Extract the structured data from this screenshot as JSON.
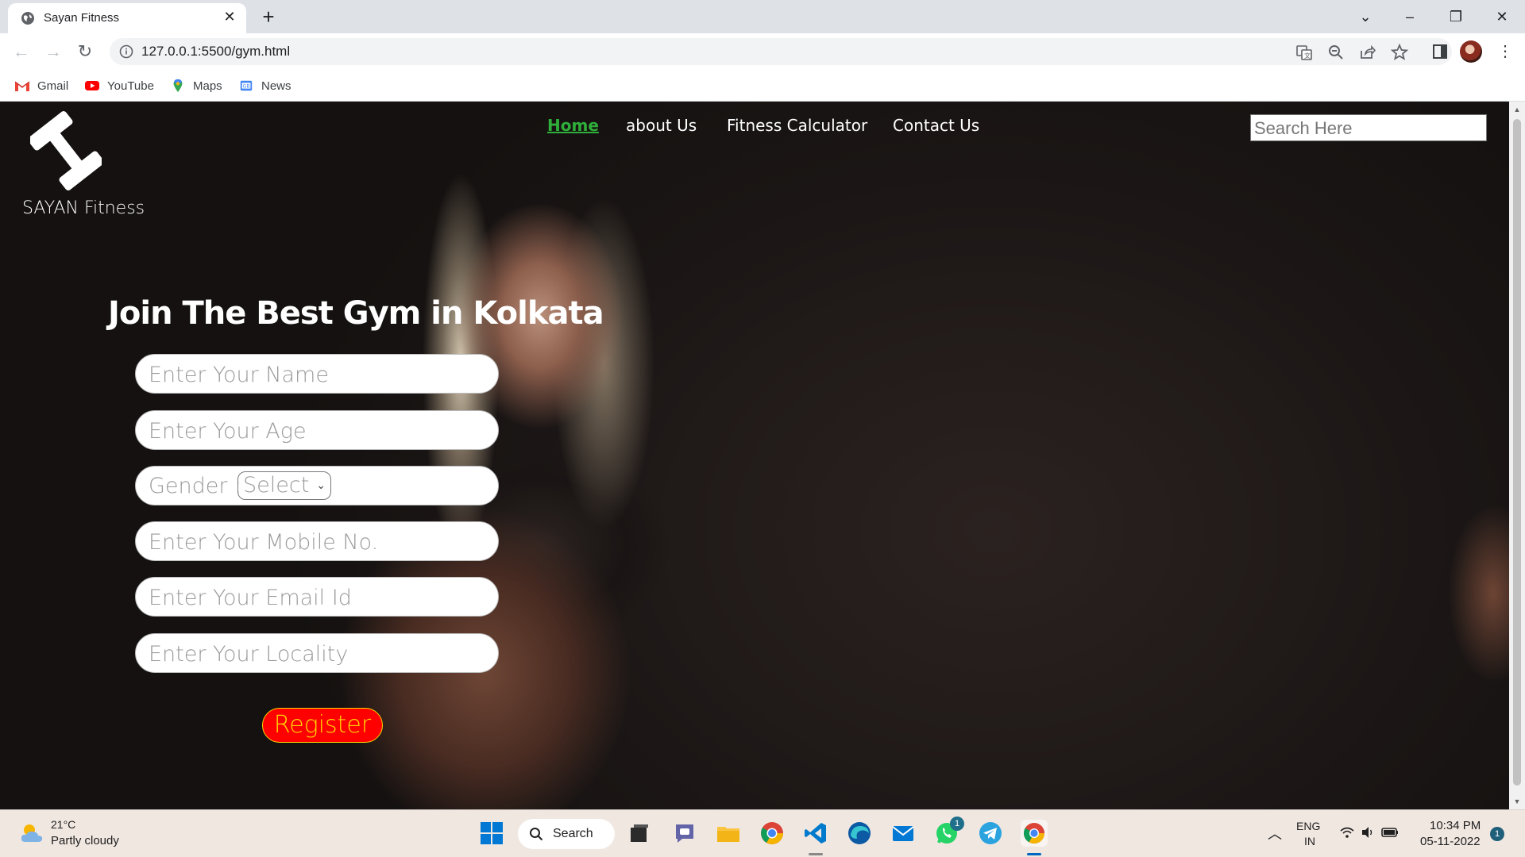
{
  "browser": {
    "tab_title": "Sayan Fitness",
    "url": "127.0.0.1:5500/gym.html",
    "bookmarks": [
      "Gmail",
      "YouTube",
      "Maps",
      "News"
    ]
  },
  "site": {
    "brand": "SAYAN Fitness",
    "nav": [
      "Home",
      "about Us",
      "Fitness Calculator",
      "Contact Us"
    ],
    "search_placeholder": "Search Here",
    "hero_title": "Join The Best Gym in Kolkata",
    "form": {
      "name_placeholder": "Enter Your Name",
      "age_placeholder": "Enter Your Age",
      "gender_label": "Gender :",
      "gender_selected": "Select",
      "mobile_placeholder": "Enter Your Mobile No.",
      "email_placeholder": "Enter Your Email Id",
      "locality_placeholder": "Enter Your Locality",
      "register_label": "Register"
    },
    "colors": {
      "active_nav": "#2fae3a",
      "register_bg": "#ff0000",
      "register_text": "#ffd400"
    }
  },
  "taskbar": {
    "weather_temp": "21°C",
    "weather_desc": "Partly cloudy",
    "search_label": "Search",
    "whatsapp_badge": "1",
    "lang_top": "ENG",
    "lang_bottom": "IN",
    "time": "10:34 PM",
    "date": "05-11-2022",
    "notification_count": "1"
  }
}
